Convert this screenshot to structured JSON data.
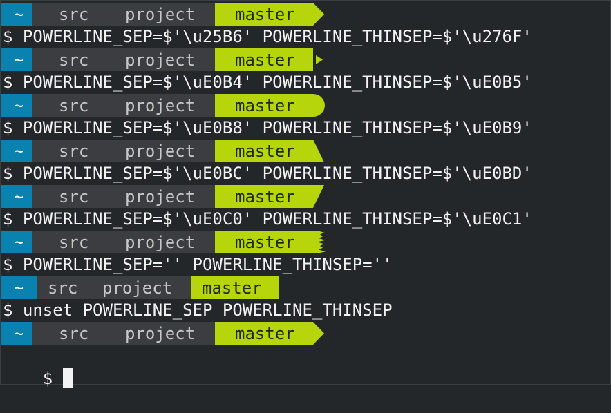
{
  "terminal": {
    "prompt_segments": {
      "home": "~",
      "dir1": "src",
      "dir2": "project",
      "branch": "master"
    },
    "commands": [
      "$ POWERLINE_SEP=$'\\u25B6' POWERLINE_THINSEP=$'\\u276F'",
      "$ POWERLINE_SEP=$'\\uE0B4' POWERLINE_THINSEP=$'\\uE0B5'",
      "$ POWERLINE_SEP=$'\\uE0B8' POWERLINE_THINSEP=$'\\uE0B9'",
      "$ POWERLINE_SEP=$'\\uE0BC' POWERLINE_THINSEP=$'\\uE0BD'",
      "$ POWERLINE_SEP=$'\\uE0C0' POWERLINE_THINSEP=$'\\uE0C1'",
      "$ POWERLINE_SEP='' POWERLINE_THINSEP=''",
      "$ unset POWERLINE_SEP POWERLINE_THINSEP"
    ],
    "final_prompt": "$",
    "colors": {
      "background": "#24272a",
      "home_bg": "#0a82b0",
      "path_bg": "#3b3d40",
      "branch_bg": "#b6d50b",
      "branch_fg": "#1f2a05",
      "path_fg": "#c8c8c8",
      "thinsep": "#8d8f91"
    },
    "prompt_styles": [
      "arrow",
      "triangle",
      "round",
      "slant-back",
      "slant-forward",
      "flame",
      "flat",
      "arrow"
    ]
  }
}
